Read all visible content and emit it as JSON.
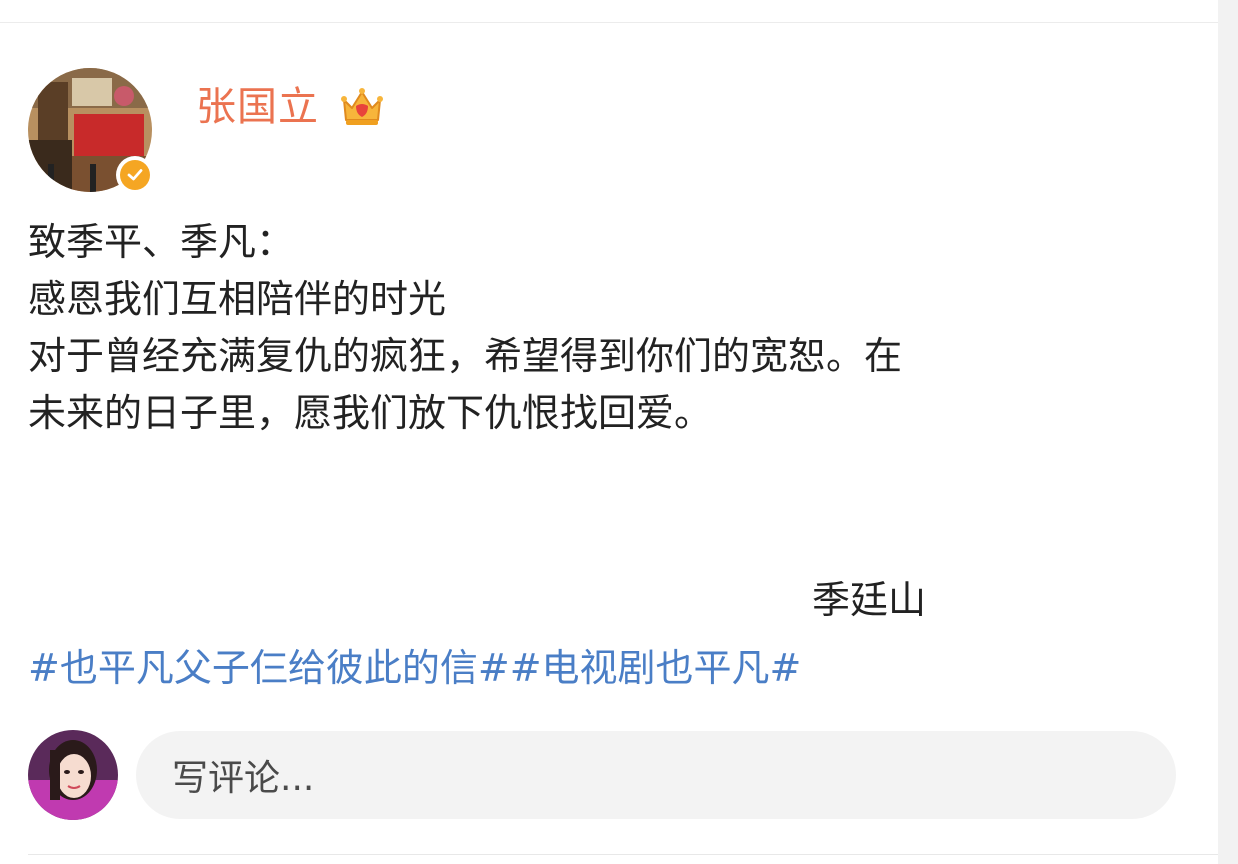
{
  "post": {
    "author": {
      "name": "张国立",
      "avatar_icon": "author-avatar",
      "verified_color": "#f5a623",
      "member_icon": "crown-icon",
      "name_color": "#eb7350"
    },
    "lines": [
      "致季平、季凡：",
      "感恩我们互相陪伴的时光",
      "对于曾经充满复仇的疯狂，希望得到你们的宽恕。在",
      "未来的日子里，愿我们放下仇恨找回爱。"
    ],
    "signature": "季廷山",
    "hashtags": [
      "#也平凡父子仨给彼此的信#",
      "#电视剧也平凡#"
    ],
    "hashtag_color": "#4a7ec6"
  },
  "comment_bar": {
    "placeholder": "写评论..."
  }
}
